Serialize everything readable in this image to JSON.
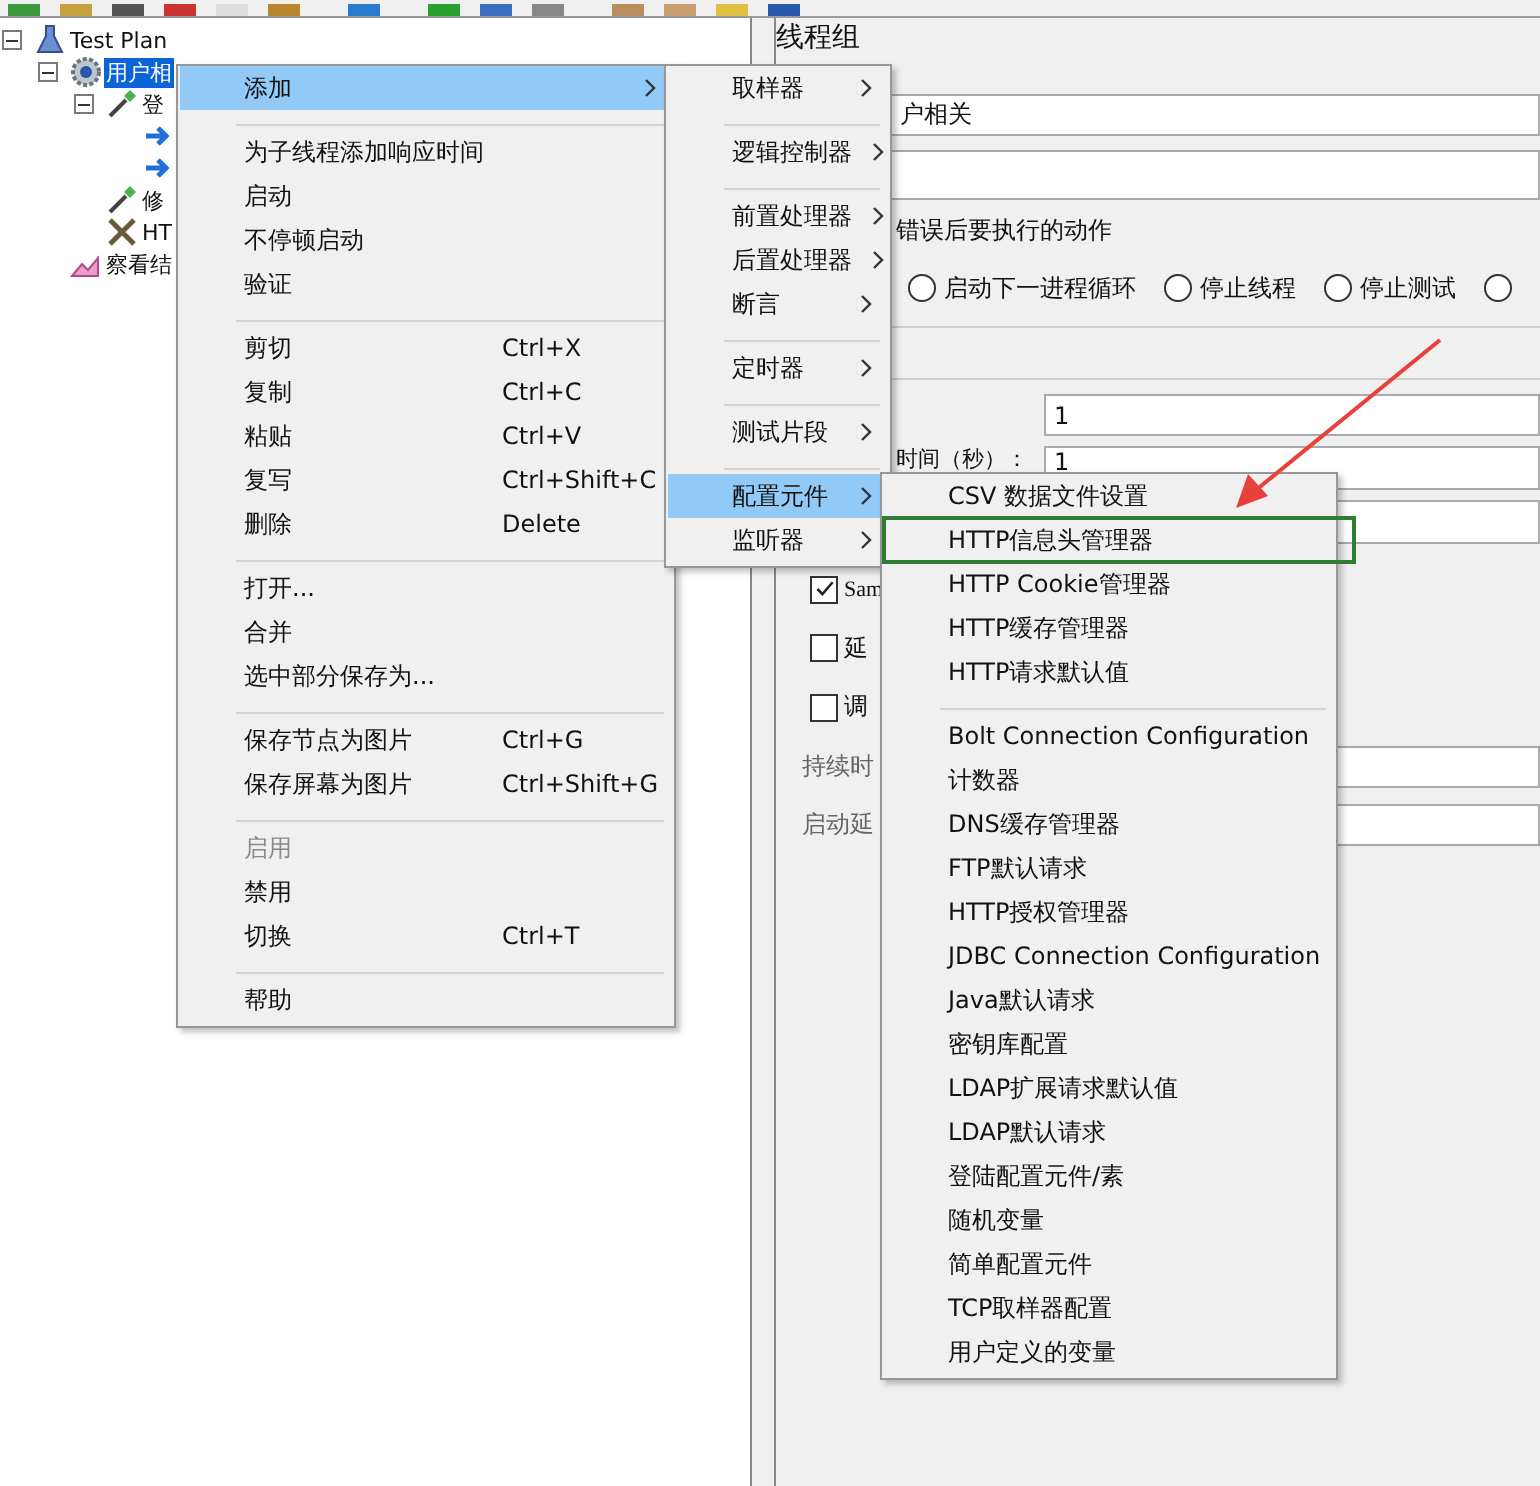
{
  "tree": [
    {
      "label": "Test Plan",
      "kind": "plan",
      "expanded": true,
      "selected": false,
      "children": [
        {
          "label": "用户相",
          "kind": "thread-group",
          "expanded": true,
          "selected": true,
          "children": [
            {
              "label": "登",
              "kind": "controller",
              "expanded": true,
              "selected": false,
              "children": [
                {
                  "kind": "sampler",
                  "selected": false
                },
                {
                  "kind": "sampler",
                  "selected": false
                }
              ]
            },
            {
              "label": "修",
              "kind": "controller",
              "selected": false
            },
            {
              "label": "HT",
              "kind": "config",
              "selected": false
            }
          ]
        },
        {
          "label": "察看结",
          "kind": "listener",
          "selected": false
        }
      ]
    }
  ],
  "panel": {
    "title": "线程组",
    "name_value": "户相关",
    "error_action_legend": "错误后要执行的动作",
    "error_actions": [
      {
        "label": "启动下一进程循环",
        "selected": false
      },
      {
        "label": "停止线程",
        "selected": false
      },
      {
        "label": "停止测试",
        "selected": false
      },
      {
        "selected": false
      }
    ],
    "thread_count_value": "1",
    "ramp_up_label": "时间（秒）：",
    "ramp_up_value": "1",
    "checkboxes": [
      {
        "label": "Sam",
        "checked": true
      },
      {
        "label": "延",
        "checked": false
      },
      {
        "label": "调",
        "checked": false
      }
    ],
    "duration_label": "持续时",
    "delay_label": "启动延"
  },
  "menus": [
    {
      "items": [
        {
          "kind": "item",
          "label": "添加",
          "submenu": true,
          "selected": true,
          "disabled": false
        },
        {
          "kind": "separator"
        },
        {
          "kind": "item",
          "label": "为子线程添加响应时间",
          "submenu": false,
          "selected": false,
          "disabled": false
        },
        {
          "kind": "item",
          "label": "启动",
          "submenu": false,
          "selected": false,
          "disabled": false
        },
        {
          "kind": "item",
          "label": "不停顿启动",
          "submenu": false,
          "selected": false,
          "disabled": false
        },
        {
          "kind": "item",
          "label": "验证",
          "submenu": false,
          "selected": false,
          "disabled": false
        },
        {
          "kind": "separator"
        },
        {
          "kind": "item",
          "label": "剪切",
          "shortcut": "Ctrl+X",
          "submenu": false,
          "selected": false,
          "disabled": false
        },
        {
          "kind": "item",
          "label": "复制",
          "shortcut": "Ctrl+C",
          "submenu": false,
          "selected": false,
          "disabled": false
        },
        {
          "kind": "item",
          "label": "粘贴",
          "shortcut": "Ctrl+V",
          "submenu": false,
          "selected": false,
          "disabled": false
        },
        {
          "kind": "item",
          "label": "复写",
          "shortcut": "Ctrl+Shift+C",
          "submenu": false,
          "selected": false,
          "disabled": false
        },
        {
          "kind": "item",
          "label": "删除",
          "shortcut": "Delete",
          "submenu": false,
          "selected": false,
          "disabled": false
        },
        {
          "kind": "separator"
        },
        {
          "kind": "item",
          "label": "打开...",
          "submenu": false,
          "selected": false,
          "disabled": false
        },
        {
          "kind": "item",
          "label": "合并",
          "submenu": false,
          "selected": false,
          "disabled": false
        },
        {
          "kind": "item",
          "label": "选中部分保存为...",
          "submenu": false,
          "selected": false,
          "disabled": false
        },
        {
          "kind": "separator"
        },
        {
          "kind": "item",
          "label": "保存节点为图片",
          "shortcut": "Ctrl+G",
          "submenu": false,
          "selected": false,
          "disabled": false
        },
        {
          "kind": "item",
          "label": "保存屏幕为图片",
          "shortcut": "Ctrl+Shift+G",
          "submenu": false,
          "selected": false,
          "disabled": false
        },
        {
          "kind": "separator"
        },
        {
          "kind": "item",
          "label": "启用",
          "submenu": false,
          "selected": false,
          "disabled": true
        },
        {
          "kind": "item",
          "label": "禁用",
          "submenu": false,
          "selected": false,
          "disabled": false
        },
        {
          "kind": "item",
          "label": "切换",
          "shortcut": "Ctrl+T",
          "submenu": false,
          "selected": false,
          "disabled": false
        },
        {
          "kind": "separator"
        },
        {
          "kind": "item",
          "label": "帮助",
          "submenu": false,
          "selected": false,
          "disabled": false
        }
      ]
    },
    {
      "items": [
        {
          "kind": "item",
          "label": "取样器",
          "submenu": true,
          "selected": false,
          "disabled": false
        },
        {
          "kind": "separator"
        },
        {
          "kind": "item",
          "label": "逻辑控制器",
          "submenu": true,
          "selected": false,
          "disabled": false
        },
        {
          "kind": "separator"
        },
        {
          "kind": "item",
          "label": "前置处理器",
          "submenu": true,
          "selected": false,
          "disabled": false
        },
        {
          "kind": "item",
          "label": "后置处理器",
          "submenu": true,
          "selected": false,
          "disabled": false
        },
        {
          "kind": "item",
          "label": "断言",
          "submenu": true,
          "selected": false,
          "disabled": false
        },
        {
          "kind": "separator"
        },
        {
          "kind": "item",
          "label": "定时器",
          "submenu": true,
          "selected": false,
          "disabled": false
        },
        {
          "kind": "separator"
        },
        {
          "kind": "item",
          "label": "测试片段",
          "submenu": true,
          "selected": false,
          "disabled": false
        },
        {
          "kind": "separator"
        },
        {
          "kind": "item",
          "label": "配置元件",
          "submenu": true,
          "selected": true,
          "disabled": false
        },
        {
          "kind": "item",
          "label": "监听器",
          "submenu": true,
          "selected": false,
          "disabled": false
        }
      ]
    },
    {
      "items": [
        {
          "kind": "item",
          "label": "CSV 数据文件设置",
          "submenu": false,
          "selected": false,
          "disabled": false
        },
        {
          "kind": "item",
          "label": "HTTP信息头管理器",
          "submenu": false,
          "selected": false,
          "disabled": false
        },
        {
          "kind": "item",
          "label": "HTTP Cookie管理器",
          "submenu": false,
          "selected": false,
          "disabled": false
        },
        {
          "kind": "item",
          "label": "HTTP缓存管理器",
          "submenu": false,
          "selected": false,
          "disabled": false
        },
        {
          "kind": "item",
          "label": "HTTP请求默认值",
          "submenu": false,
          "selected": false,
          "disabled": false
        },
        {
          "kind": "separator"
        },
        {
          "kind": "item",
          "label": "Bolt Connection Configuration",
          "submenu": false,
          "selected": false,
          "disabled": false
        },
        {
          "kind": "item",
          "label": "计数器",
          "submenu": false,
          "selected": false,
          "disabled": false
        },
        {
          "kind": "item",
          "label": "DNS缓存管理器",
          "submenu": false,
          "selected": false,
          "disabled": false
        },
        {
          "kind": "item",
          "label": "FTP默认请求",
          "submenu": false,
          "selected": false,
          "disabled": false
        },
        {
          "kind": "item",
          "label": "HTTP授权管理器",
          "submenu": false,
          "selected": false,
          "disabled": false
        },
        {
          "kind": "item",
          "label": "JDBC Connection Configuration",
          "submenu": false,
          "selected": false,
          "disabled": false
        },
        {
          "kind": "item",
          "label": "Java默认请求",
          "submenu": false,
          "selected": false,
          "disabled": false
        },
        {
          "kind": "item",
          "label": "密钥库配置",
          "submenu": false,
          "selected": false,
          "disabled": false
        },
        {
          "kind": "item",
          "label": "LDAP扩展请求默认值",
          "submenu": false,
          "selected": false,
          "disabled": false
        },
        {
          "kind": "item",
          "label": "LDAP默认请求",
          "submenu": false,
          "selected": false,
          "disabled": false
        },
        {
          "kind": "item",
          "label": "登陆配置元件/素",
          "submenu": false,
          "selected": false,
          "disabled": false
        },
        {
          "kind": "item",
          "label": "随机变量",
          "submenu": false,
          "selected": false,
          "disabled": false
        },
        {
          "kind": "item",
          "label": "简单配置元件",
          "submenu": false,
          "selected": false,
          "disabled": false
        },
        {
          "kind": "item",
          "label": "TCP取样器配置",
          "submenu": false,
          "selected": false,
          "disabled": false
        },
        {
          "kind": "item",
          "label": "用户定义的变量",
          "submenu": false,
          "selected": false,
          "disabled": false
        }
      ]
    }
  ],
  "annotations": [
    {
      "kind": "highlight",
      "color": "#2e7d32"
    },
    {
      "kind": "arrow",
      "color": "#e8403a"
    }
  ]
}
